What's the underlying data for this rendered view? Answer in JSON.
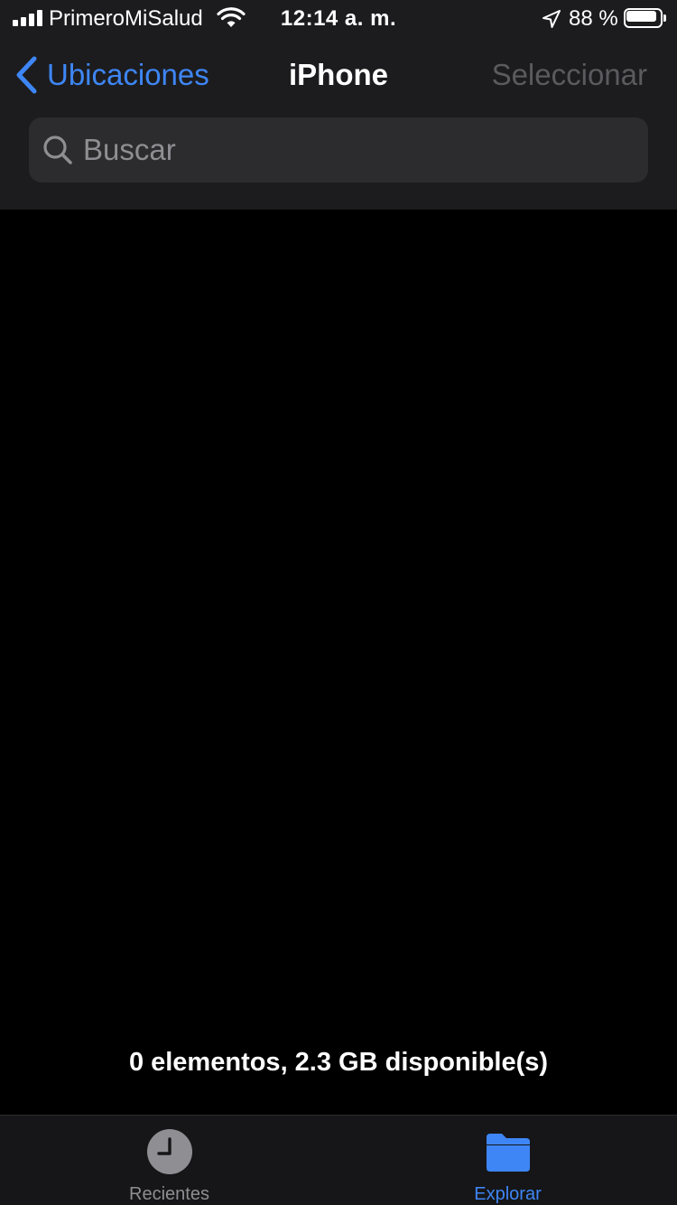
{
  "status_bar": {
    "carrier": "PrimeroMiSalud",
    "time": "12:14 a. m.",
    "battery_percent_label": "88 %",
    "battery_level": 0.88,
    "icons": [
      "signal-icon",
      "wifi-icon",
      "location-icon",
      "battery-icon"
    ]
  },
  "nav": {
    "back_label": "Ubicaciones",
    "title": "iPhone",
    "select_label": "Seleccionar"
  },
  "search": {
    "placeholder": "Buscar",
    "value": ""
  },
  "content": {
    "summary": "0 elementos, 2.3 GB disponible(s)"
  },
  "tab_bar": {
    "tabs": [
      {
        "label": "Recientes",
        "icon": "clock-icon",
        "active": false
      },
      {
        "label": "Explorar",
        "icon": "folder-icon",
        "active": true
      }
    ]
  },
  "colors": {
    "accent": "#3e86f5",
    "bar_background": "#1c1c1e",
    "search_background": "#2c2c2e",
    "disabled_text": "#5a5a5f",
    "inactive_tab": "#8e8e93"
  }
}
